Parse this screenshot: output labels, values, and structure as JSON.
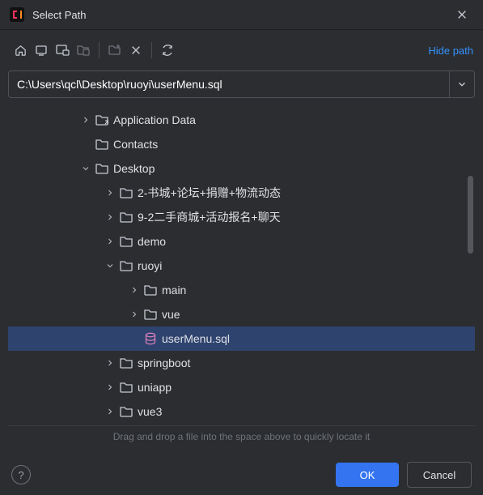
{
  "window": {
    "title": "Select Path"
  },
  "toolbar": {
    "hide_path_label": "Hide path"
  },
  "path": {
    "value": "C:\\Users\\qcl\\Desktop\\ruoyi\\userMenu.sql"
  },
  "drag_hint": "Drag and drop a file into the space above to quickly locate it",
  "buttons": {
    "ok": "OK",
    "cancel": "Cancel"
  },
  "icons": {
    "home": "home-icon",
    "desktop": "desktop-icon",
    "project": "project-icon",
    "module": "module-icon",
    "new_folder": "new-folder-icon",
    "delete": "delete-icon",
    "refresh": "refresh-icon",
    "folder": "folder-icon",
    "folder_link": "folder-link-icon",
    "dropdown": "chevron-down-icon",
    "db": "database-icon",
    "close": "close-icon",
    "help": "help-icon",
    "logo": "app-logo"
  },
  "tree": [
    {
      "indent": 90,
      "arrow": "right",
      "icon": "folder_link",
      "label": "Application Data",
      "selected": false
    },
    {
      "indent": 90,
      "arrow": "",
      "icon": "folder",
      "label": "Contacts",
      "selected": false
    },
    {
      "indent": 90,
      "arrow": "down",
      "icon": "folder",
      "label": "Desktop",
      "selected": false
    },
    {
      "indent": 120,
      "arrow": "right",
      "icon": "folder",
      "label": "2-书城+论坛+捐赠+物流动态",
      "selected": false
    },
    {
      "indent": 120,
      "arrow": "right",
      "icon": "folder",
      "label": "9-2二手商城+活动报名+聊天",
      "selected": false
    },
    {
      "indent": 120,
      "arrow": "right",
      "icon": "folder",
      "label": "demo",
      "selected": false
    },
    {
      "indent": 120,
      "arrow": "down",
      "icon": "folder",
      "label": "ruoyi",
      "selected": false
    },
    {
      "indent": 150,
      "arrow": "right",
      "icon": "folder",
      "label": "main",
      "selected": false
    },
    {
      "indent": 150,
      "arrow": "right",
      "icon": "folder",
      "label": "vue",
      "selected": false
    },
    {
      "indent": 150,
      "arrow": "",
      "icon": "db",
      "label": "userMenu.sql",
      "selected": true
    },
    {
      "indent": 120,
      "arrow": "right",
      "icon": "folder",
      "label": "springboot",
      "selected": false
    },
    {
      "indent": 120,
      "arrow": "right",
      "icon": "folder",
      "label": "uniapp",
      "selected": false
    },
    {
      "indent": 120,
      "arrow": "right",
      "icon": "folder",
      "label": "vue3",
      "selected": false
    }
  ]
}
